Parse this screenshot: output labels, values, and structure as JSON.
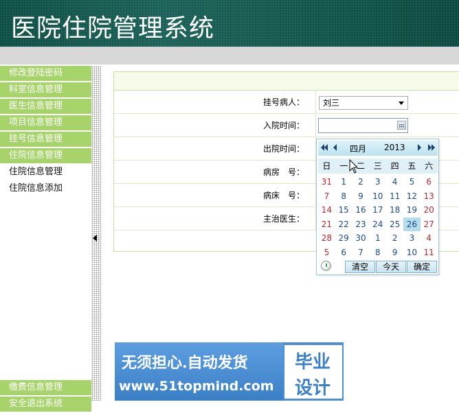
{
  "header": {
    "title": "医院住院管理系统"
  },
  "sidebar": {
    "items": [
      {
        "label": "修改登陆密码",
        "type": "head"
      },
      {
        "label": "科室信息管理",
        "type": "head"
      },
      {
        "label": "医生信息管理",
        "type": "head"
      },
      {
        "label": "项目信息管理",
        "type": "head"
      },
      {
        "label": "挂号信息管理",
        "type": "head"
      },
      {
        "label": "住院信息管理",
        "type": "head"
      },
      {
        "label": "住院信息管理",
        "type": "sub"
      },
      {
        "label": "住院信息添加",
        "type": "sub"
      }
    ],
    "bottom_items": [
      {
        "label": "缴费信息管理"
      },
      {
        "label": "安全退出系统"
      }
    ]
  },
  "form": {
    "patient_label": "挂号病人：",
    "patient_value": "刘三",
    "admit_time_label": "入院时间：",
    "discharge_time_label": "出院时间：",
    "ward_label": "病房　号：",
    "bed_label": "病床　号：",
    "doctor_label": "主治医生："
  },
  "datepicker": {
    "month": "四月",
    "year": "2013",
    "weekdays": [
      "日",
      "一",
      "二",
      "三",
      "四",
      "五",
      "六"
    ],
    "weeks": [
      [
        "31",
        "1",
        "2",
        "3",
        "4",
        "5",
        "6"
      ],
      [
        "7",
        "8",
        "9",
        "10",
        "11",
        "12",
        "13"
      ],
      [
        "14",
        "15",
        "16",
        "17",
        "18",
        "19",
        "20"
      ],
      [
        "21",
        "22",
        "23",
        "24",
        "25",
        "26",
        "27"
      ],
      [
        "28",
        "29",
        "30",
        "1",
        "2",
        "3",
        "4"
      ],
      [
        "5",
        "6",
        "7",
        "8",
        "9",
        "10",
        "11"
      ]
    ],
    "selected_day": "26",
    "clear_label": "清空",
    "today_label": "今天",
    "ok_label": "确定",
    "colors": {
      "weekend": "#c0262d",
      "day": "#1a4a8a",
      "selected_bg": "#b4dcec"
    }
  },
  "ad": {
    "line1": "无须担心.自动发货",
    "line2": "www.51topmind.com",
    "right_top": "毕业",
    "right_bottom": "设计"
  }
}
